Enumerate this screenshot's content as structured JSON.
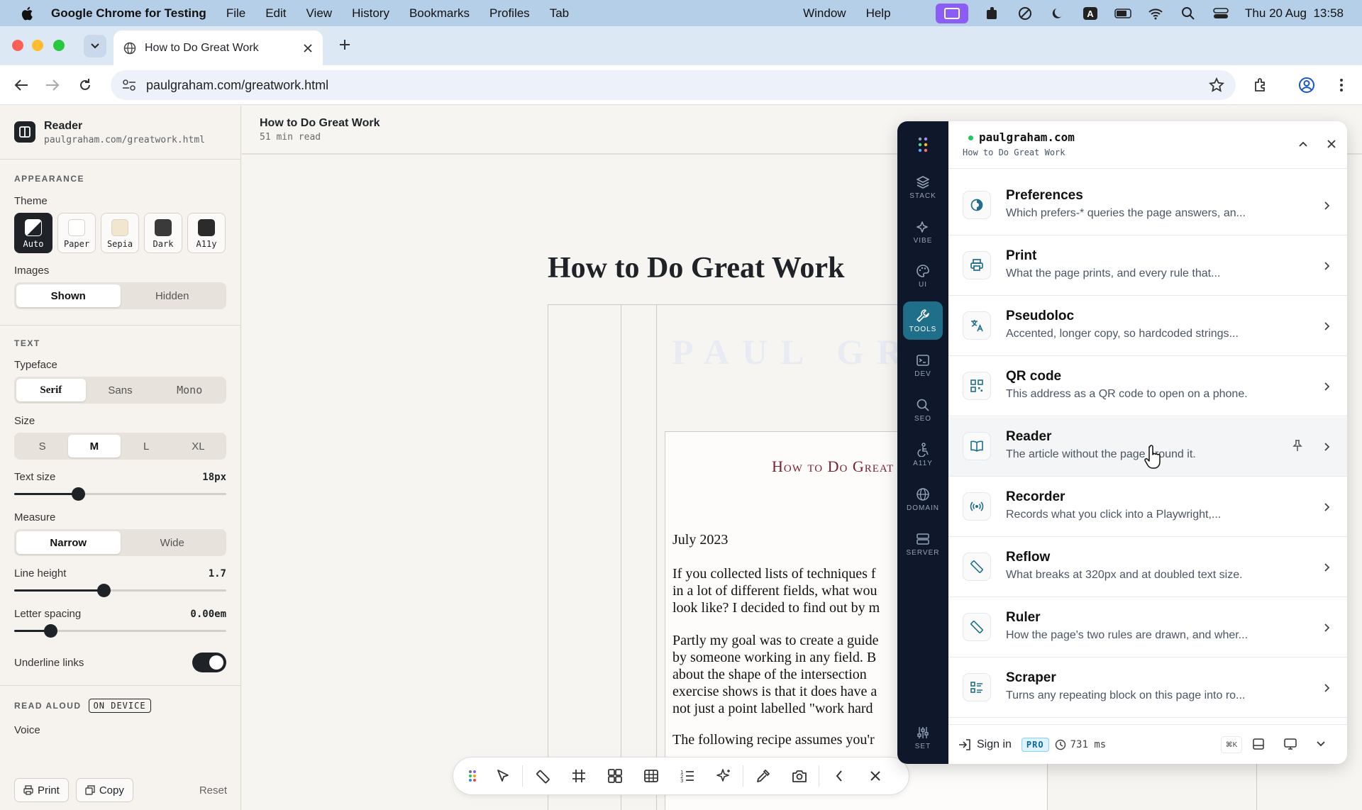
{
  "menubar": {
    "app_name": "Google Chrome for Testing",
    "items": [
      "File",
      "Edit",
      "View",
      "History",
      "Bookmarks",
      "Profiles",
      "Tab"
    ],
    "right_items": [
      "Window",
      "Help"
    ],
    "clock": "Thu 20 Aug  13:58"
  },
  "browser": {
    "tab_title": "How to Do Great Work",
    "url": "paulgraham.com/greatwork.html"
  },
  "sidebar": {
    "title": "Reader",
    "subtitle": "paulgraham.com/greatwork.html",
    "appearance_label": "APPEARANCE",
    "theme_label": "Theme",
    "themes": [
      {
        "label": "Auto",
        "swatch": "#1f2328"
      },
      {
        "label": "Paper",
        "swatch": "#ffffff"
      },
      {
        "label": "Sepia",
        "swatch": "#f1e7cf"
      },
      {
        "label": "Dark",
        "swatch": "#3a3a3a"
      },
      {
        "label": "A11y",
        "swatch": "#2b2b2b"
      }
    ],
    "images_label": "Images",
    "images_options": [
      "Shown",
      "Hidden"
    ],
    "text_label": "TEXT",
    "typeface_label": "Typeface",
    "typeface_options": [
      "Serif",
      "Sans",
      "Mono"
    ],
    "size_label": "Size",
    "size_options": [
      "S",
      "M",
      "L",
      "XL"
    ],
    "text_size_label": "Text size",
    "text_size_value": "18px",
    "text_size_fraction": 0.3,
    "measure_label": "Measure",
    "measure_options": [
      "Narrow",
      "Wide"
    ],
    "line_height_label": "Line height",
    "line_height_value": "1.7",
    "line_height_fraction": 0.42,
    "letter_spacing_label": "Letter spacing",
    "letter_spacing_value": "0.00em",
    "letter_spacing_fraction": 0.17,
    "underline_label": "Underline links",
    "read_aloud_label": "READ ALOUD",
    "on_device_badge": "ON DEVICE",
    "voice_label": "Voice",
    "print_label": "Print",
    "copy_label": "Copy",
    "reset_label": "Reset"
  },
  "content": {
    "doc_title": "How to Do Great Work",
    "doc_meta": "51 min read",
    "article_title": "How to Do Great Work",
    "logo_text": "PAUL GR",
    "inner_title": "How to Do Great",
    "date": "July 2023",
    "para1": [
      "If you collected lists of techniques f",
      "in a lot of different fields, what wou",
      "look like? I decided to find out by m"
    ],
    "para2": [
      "Partly my goal was to create a guide",
      "by someone working in any field. B",
      "about the shape of the intersection",
      "exercise shows is that it does have a",
      "not just a point labelled \"work hard"
    ],
    "para3": "The following recipe assumes you'r"
  },
  "panel": {
    "domain": "paulgraham.com",
    "page": "How to Do Great Work",
    "rail": [
      "STACK",
      "VIBE",
      "UI",
      "TOOLS",
      "DEV",
      "SEO",
      "A11Y",
      "DOMAIN",
      "SERVER"
    ],
    "rail_bottom": "SET",
    "tools": [
      {
        "name": "Preferences",
        "desc": "Which prefers-* queries the page answers, an...",
        "icon": "contrast-icon"
      },
      {
        "name": "Print",
        "desc": "What the page prints, and every rule that...",
        "icon": "printer-icon"
      },
      {
        "name": "Pseudoloc",
        "desc": "Accented, longer copy, so hardcoded strings...",
        "icon": "translate-icon"
      },
      {
        "name": "QR code",
        "desc": "This address as a QR code to open on a phone.",
        "icon": "qr-code-icon"
      },
      {
        "name": "Reader",
        "desc": "The article without the page around it.",
        "icon": "book-icon"
      },
      {
        "name": "Recorder",
        "desc": "Records what you click into a Playwright,...",
        "icon": "broadcast-icon"
      },
      {
        "name": "Reflow",
        "desc": "What breaks at 320px and at doubled text size.",
        "icon": "ruler-icon"
      },
      {
        "name": "Ruler",
        "desc": "How the page's two rules are drawn, and wher...",
        "icon": "ruler-icon"
      },
      {
        "name": "Scraper",
        "desc": "Turns any repeating block on this page into ro...",
        "icon": "list-icon"
      }
    ],
    "sign_in": "Sign in",
    "pro_badge": "PRO",
    "latency": "731 ms",
    "shortcut": "⌘K",
    "accent": "#1f6f8b"
  }
}
